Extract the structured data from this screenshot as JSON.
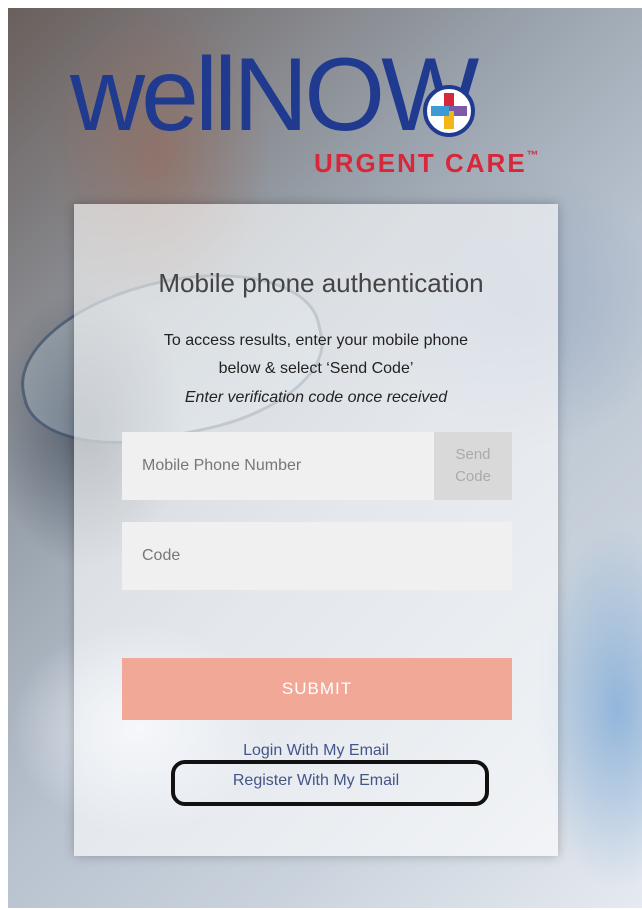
{
  "logo": {
    "brand": "wellNOW",
    "subtitle": "URGENT CARE",
    "tm": "™"
  },
  "auth": {
    "title": "Mobile phone authentication",
    "instruction_line1": "To access results, enter your mobile phone",
    "instruction_line2": "below & select ‘Send Code’",
    "instruction_line3": "Enter verification code once received"
  },
  "phone": {
    "placeholder": "Mobile Phone Number",
    "send_code_line1": "Send",
    "send_code_line2": "Code"
  },
  "code": {
    "placeholder": "Code"
  },
  "submit_label": "SUBMIT",
  "links": {
    "login_email": "Login With My Email",
    "register_email": "Register With My Email"
  },
  "colors": {
    "brand_blue": "#1f3a8f",
    "brand_red": "#d6283a",
    "submit": "#f2a896"
  }
}
